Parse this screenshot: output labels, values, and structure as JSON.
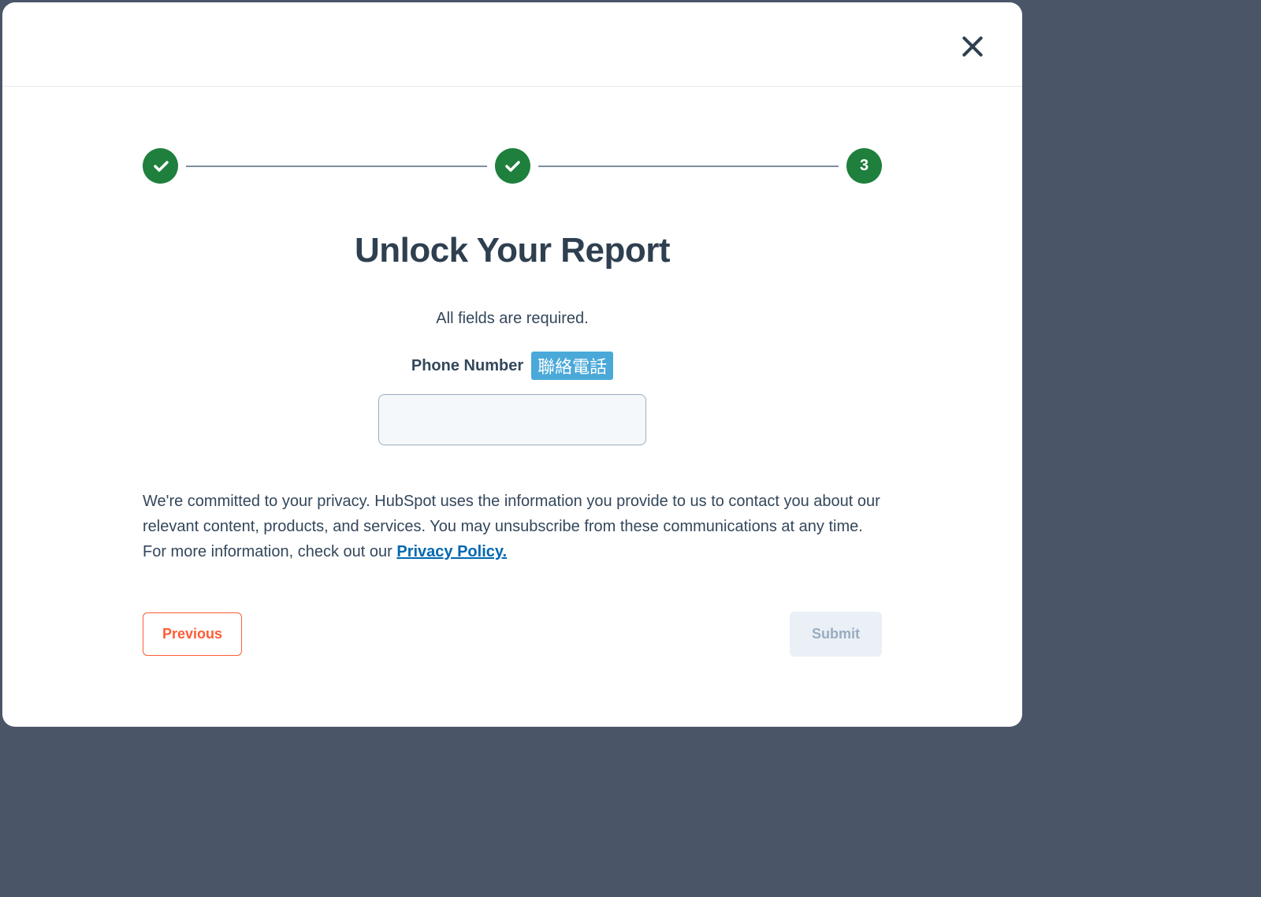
{
  "stepper": {
    "step3_number": "3"
  },
  "title": "Unlock Your Report",
  "subtitle": "All fields are required.",
  "form": {
    "phone_label": "Phone Number",
    "phone_badge": "聯絡電話",
    "phone_value": ""
  },
  "privacy": {
    "text_before": "We're committed to your privacy. HubSpot uses the information you provide to us to contact you about our relevant content, products, and services. You may unsubscribe from these communications at any time. For more information, check out our ",
    "link_text": "Privacy Policy."
  },
  "buttons": {
    "previous": "Previous",
    "submit": "Submit"
  }
}
